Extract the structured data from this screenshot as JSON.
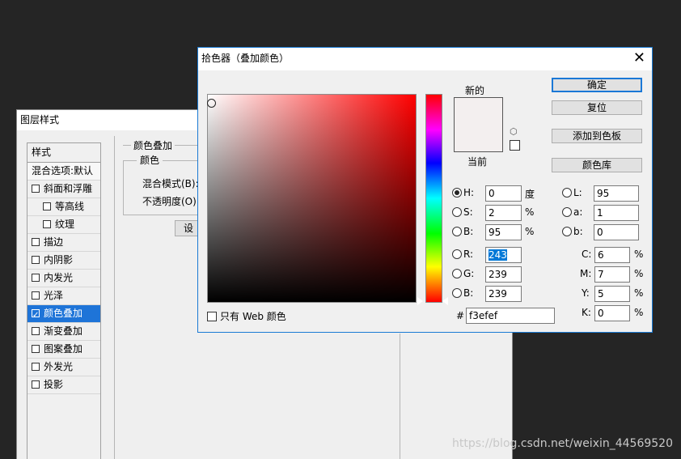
{
  "layer_style": {
    "title": "图层样式",
    "header": "样式",
    "items": [
      {
        "label": "混合选项:默认",
        "checkbox": false
      },
      {
        "label": "斜面和浮雕",
        "checkbox": true,
        "checked": false
      },
      {
        "label": "等高线",
        "checkbox": true,
        "checked": false,
        "sub": true
      },
      {
        "label": "纹理",
        "checkbox": true,
        "checked": false,
        "sub": true
      },
      {
        "label": "描边",
        "checkbox": true,
        "checked": false
      },
      {
        "label": "内阴影",
        "checkbox": true,
        "checked": false
      },
      {
        "label": "内发光",
        "checkbox": true,
        "checked": false
      },
      {
        "label": "光泽",
        "checkbox": true,
        "checked": false
      },
      {
        "label": "颜色叠加",
        "checkbox": true,
        "checked": true,
        "selected": true
      },
      {
        "label": "渐变叠加",
        "checkbox": true,
        "checked": false
      },
      {
        "label": "图案叠加",
        "checkbox": true,
        "checked": false
      },
      {
        "label": "外发光",
        "checkbox": true,
        "checked": false
      },
      {
        "label": "投影",
        "checkbox": true,
        "checked": false
      }
    ],
    "panel": {
      "group_title": "颜色叠加",
      "sub_title": "颜色",
      "blend_mode_label": "混合模式(B):",
      "opacity_label": "不透明度(O):",
      "set_button": "设置"
    }
  },
  "color_picker": {
    "title": "拾色器（叠加颜色）",
    "new_label": "新的",
    "current_label": "当前",
    "new_color": "#f3efef",
    "current_color": "#f3efef",
    "web_only_label": "只有 Web 颜色",
    "buttons": {
      "ok": "确定",
      "reset": "复位",
      "add_swatch": "添加到色板",
      "color_libraries": "颜色库"
    },
    "hsb": {
      "h_label": "H:",
      "h_value": "0",
      "h_unit": "度",
      "s_label": "S:",
      "s_value": "2",
      "s_unit": "%",
      "b_label": "B:",
      "b_value": "95",
      "b_unit": "%"
    },
    "rgb": {
      "r_label": "R:",
      "r_value": "243",
      "g_label": "G:",
      "g_value": "239",
      "b_label": "B:",
      "b_value": "239"
    },
    "lab": {
      "l_label": "L:",
      "l_value": "95",
      "a_label": "a:",
      "a_value": "1",
      "b_label": "b:",
      "b_value": "0"
    },
    "cmyk": {
      "c_label": "C:",
      "c_value": "6",
      "m_label": "M:",
      "m_value": "7",
      "y_label": "Y:",
      "y_value": "5",
      "k_label": "K:",
      "k_value": "0",
      "unit": "%"
    },
    "hex_label": "#",
    "hex_value": "f3efef",
    "selected_mode": "H"
  },
  "watermark": "https://blog.csdn.net/weixin_44569520"
}
